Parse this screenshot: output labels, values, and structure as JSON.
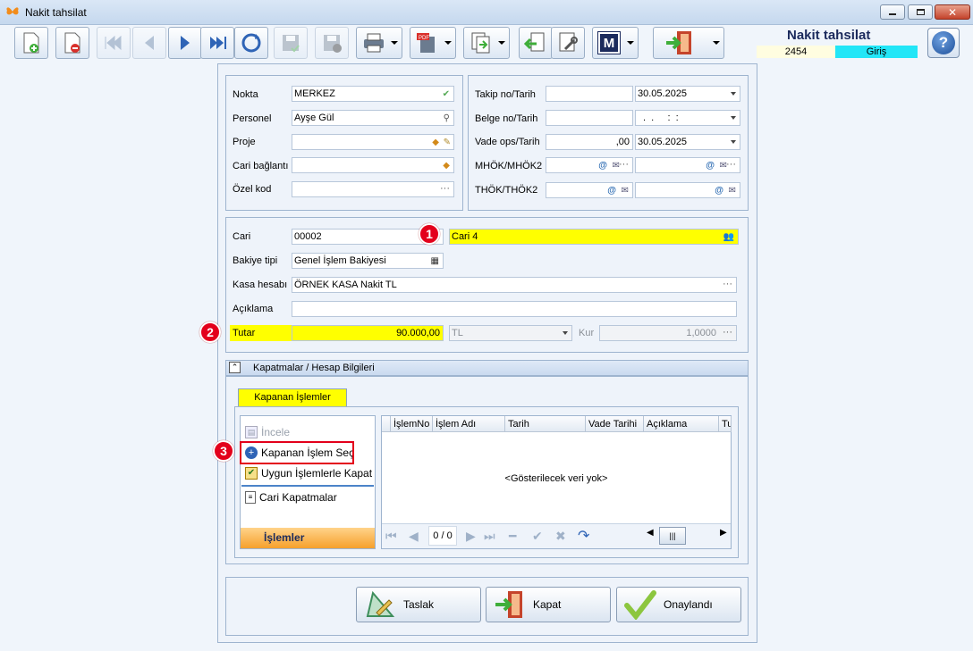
{
  "window": {
    "title": "Nakit tahsilat"
  },
  "header": {
    "title": "Nakit tahsilat",
    "number": "2454",
    "mode": "Giriş"
  },
  "toolbar": {
    "items": [
      "new-document-icon",
      "delete-document-icon",
      "first-record-icon",
      "previous-record-icon",
      "next-record-icon",
      "last-record-icon",
      "refresh-icon",
      "save-icon",
      "save-close-icon",
      "print-icon",
      "pdf-icon",
      "copy-icon",
      "import-icon",
      "settings-icon",
      "m-logo-icon",
      "exit-icon"
    ]
  },
  "form_left": {
    "nokta": {
      "label": "Nokta",
      "value": "MERKEZ"
    },
    "personel": {
      "label": "Personel",
      "value": "Ayşe Gül"
    },
    "proje": {
      "label": "Proje",
      "value": ""
    },
    "cari_baglanti": {
      "label": "Cari bağlantı",
      "value": ""
    },
    "ozel_kod": {
      "label": "Özel kod",
      "value": ""
    }
  },
  "form_right": {
    "takip": {
      "label": "Takip no/Tarih",
      "value": "",
      "date": "30.05.2025"
    },
    "belge": {
      "label": "Belge no/Tarih",
      "value": "",
      "date": ".  .     :  :"
    },
    "vade": {
      "label": "Vade ops/Tarih",
      "value": ",00",
      "date": "30.05.2025"
    },
    "mhok": {
      "label": "MHÖK/MHÖK2"
    },
    "thok": {
      "label": "THÖK/THÖK2"
    }
  },
  "cari_section": {
    "cari": {
      "label": "Cari",
      "code": "00002",
      "name": "Cari 4"
    },
    "bakiye": {
      "label": "Bakiye tipi",
      "value": "Genel İşlem Bakiyesi"
    },
    "kasa": {
      "label": "Kasa hesabı",
      "value": "ÖRNEK KASA Nakit TL"
    },
    "aciklama": {
      "label": "Açıklama",
      "value": ""
    },
    "tutar": {
      "label": "Tutar",
      "value": "90.000,00",
      "currency": "TL",
      "kur_label": "Kur",
      "kur": "1,0000"
    }
  },
  "badges": [
    "1",
    "2",
    "3"
  ],
  "kapatmalar": {
    "section_title": "Kapatmalar / Hesap Bilgileri",
    "tab": "Kapanan İşlemler",
    "side_items": {
      "incele": "İncele",
      "kapanan_sec": "Kapanan İşlem Seç",
      "uygun": "Uygun İşlemlerle Kapat",
      "cari_kapatmalar": "Cari Kapatmalar"
    },
    "side_footer": "İşlemler",
    "columns": [
      "İşlemNo",
      "İşlem Adı",
      "Tarih",
      "Vade Tarihi",
      "Açıklama",
      "Tu"
    ],
    "empty_text": "<Gösterilecek veri yok>",
    "nav_text": "0 / 0"
  },
  "buttons": {
    "taslak": "Taslak",
    "kapat": "Kapat",
    "onaylandi": "Onaylandı"
  },
  "colors": {
    "highlight": "#ffff00",
    "badge": "#e3001b",
    "mode": "#22e6f7",
    "header_title": "#1b2a5c"
  }
}
